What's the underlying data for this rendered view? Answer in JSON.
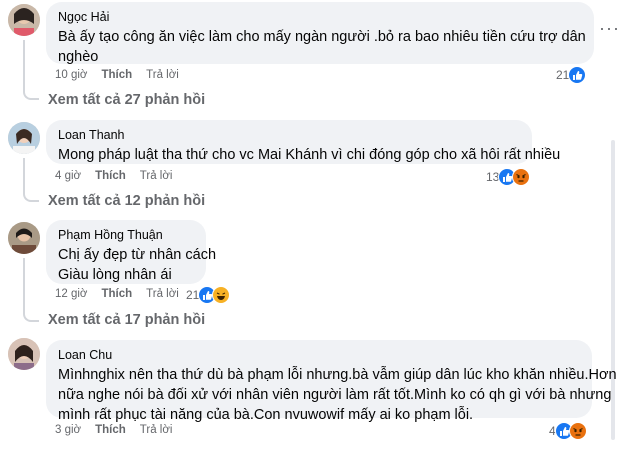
{
  "comments": [
    {
      "author": "Ngọc Hải",
      "lines": [
        "Bà ấy tạo công ăn việc làm cho mấy ngàn người .bỏ ra bao nhiêu tiền cứu trợ dân",
        "nghèo"
      ],
      "time": "10 giờ",
      "like": "Thích",
      "reply": "Trả lời",
      "reaction_count": "21",
      "reaction_icons": [
        "like-icon"
      ],
      "view_replies": "Xem tất cả 27 phản hồi"
    },
    {
      "author": "Loan Thanh",
      "lines": [
        "Mong pháp luật tha thứ cho vc Mai Khánh vì chi đóng góp cho xã hôi rất nhiều"
      ],
      "time": "4 giờ",
      "like": "Thích",
      "reply": "Trả lời",
      "reaction_count": "13",
      "reaction_icons": [
        "like-icon",
        "angry-icon"
      ],
      "view_replies": "Xem tất cả 12 phản hồi"
    },
    {
      "author": "Phạm Hồng Thuận",
      "lines": [
        "Chị ấy đẹp từ nhân cách",
        "Giàu lòng nhân ái"
      ],
      "time": "12 giờ",
      "like": "Thích",
      "reply": "Trả lời",
      "reaction_count": "21",
      "reaction_icons": [
        "like-icon",
        "haha-icon"
      ],
      "view_replies": "Xem tất cả 17 phản hồi"
    },
    {
      "author": "Loan Chu",
      "lines": [
        "Mìnhnghix nên tha thứ dù bà phạm lỗi nhưng.bà vẫm giúp dân lúc kho khăn nhiều.Hơn",
        "nữa nghe nói bà đối xử với nhân viên người làm rất tốt.Mình ko có qh gì với bà nhưng",
        "mình rất phục tài năng của bà.Con nvuwowif mấy ai ko phạm lỗi."
      ],
      "time": "3 giờ",
      "like": "Thích",
      "reply": "Trả lời",
      "reaction_count": "4",
      "reaction_icons": [
        "like-icon",
        "angry-icon"
      ]
    }
  ],
  "colors": {
    "bubble": "#f0f2f5",
    "meta_text": "#65676b",
    "like_blue": "#1877f2",
    "angry_orange": "#e9710f",
    "haha_yellow": "#f7b125"
  }
}
